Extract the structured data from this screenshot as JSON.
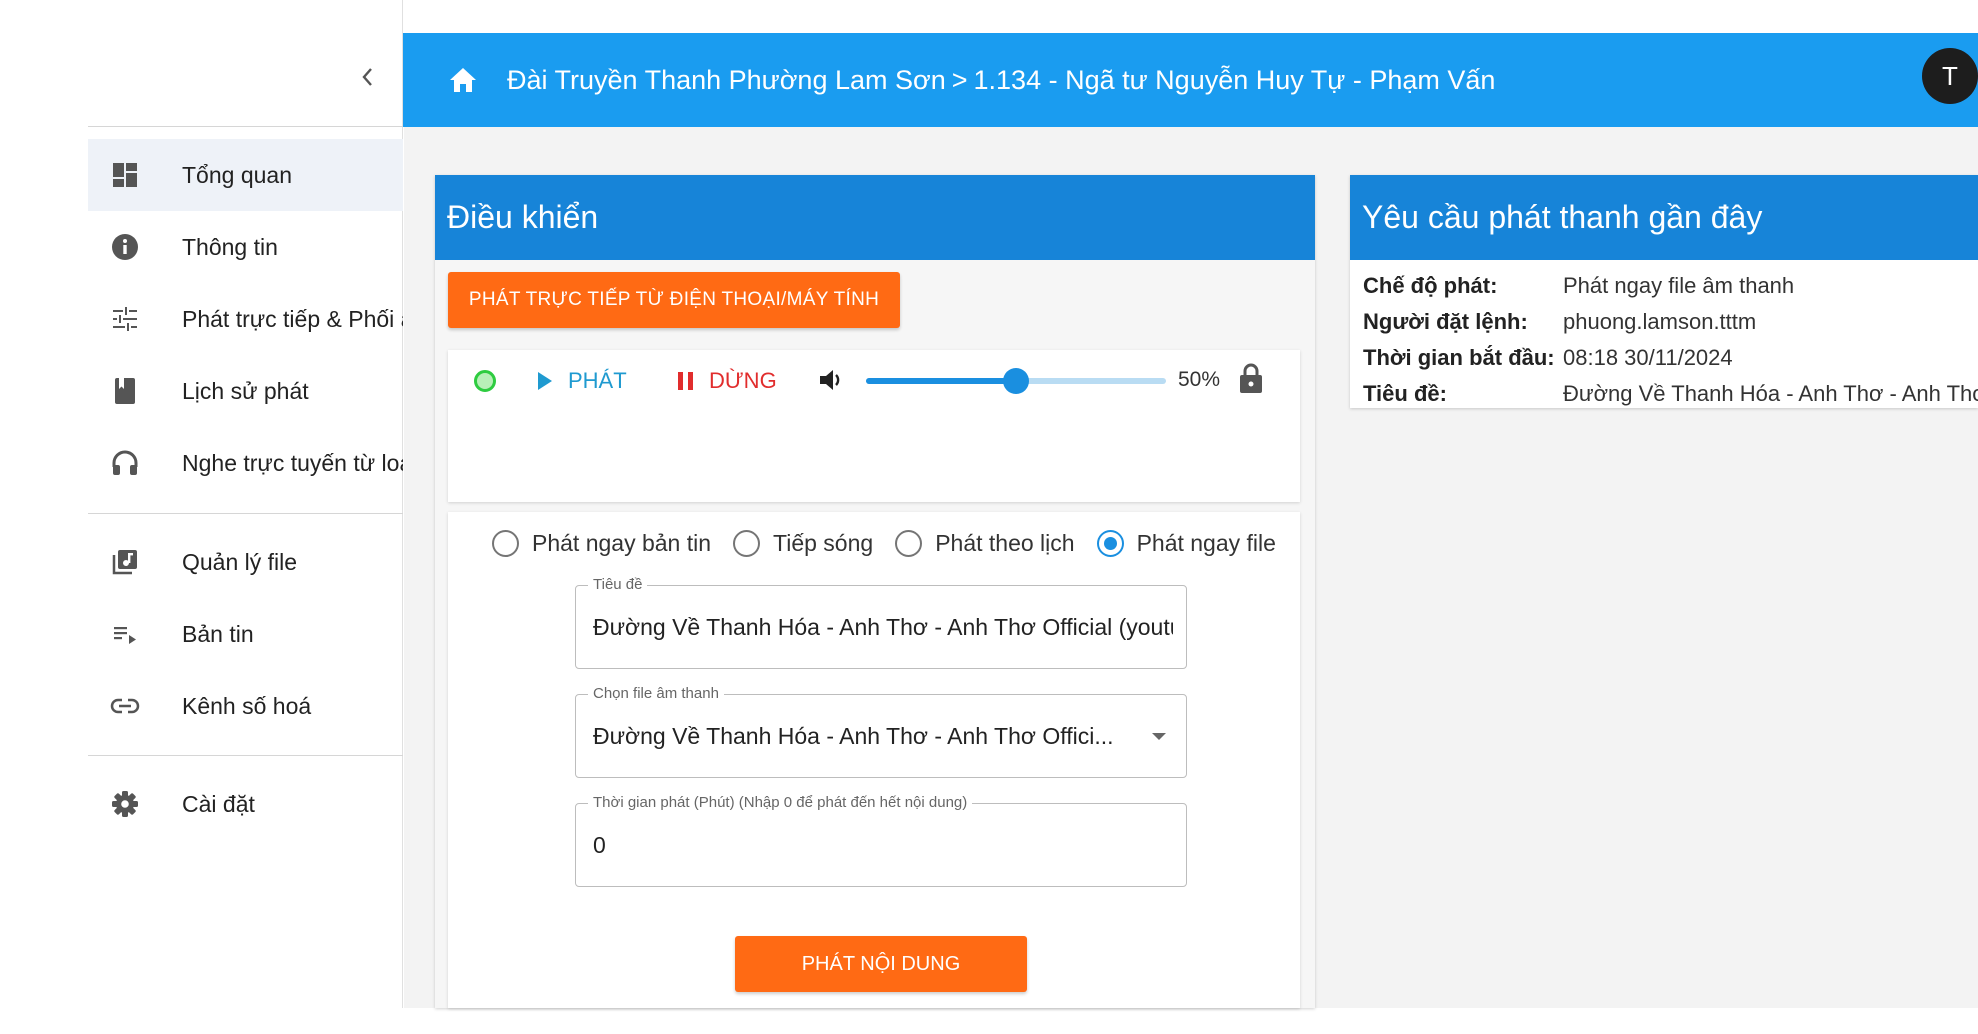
{
  "sidebar": {
    "items": [
      {
        "label": "Tổng quan",
        "icon": "dashboard-icon",
        "active": true
      },
      {
        "label": "Thông tin",
        "icon": "info-icon"
      },
      {
        "label": "Phát trực tiếp & Phối âm",
        "icon": "mixer-sliders-icon"
      },
      {
        "label": "Lịch sử phát",
        "icon": "book-icon"
      },
      {
        "label": "Nghe trực tuyến từ loa",
        "icon": "headphones-icon"
      },
      {
        "label": "Quản lý file",
        "icon": "library-music-icon"
      },
      {
        "label": "Bản tin",
        "icon": "playlist-play-icon"
      },
      {
        "label": "Kênh số hoá",
        "icon": "link-icon"
      },
      {
        "label": "Cài đặt",
        "icon": "gear-icon"
      }
    ]
  },
  "header": {
    "breadcrumb_root": "Đài Truyền Thanh Phường Lam Sơn",
    "breadcrumb_sep": ">",
    "breadcrumb_current": "1.134 - Ngã tư Nguyễn Huy Tự - Phạm Vấn",
    "avatar_initial": "T",
    "color": "#1a9cf0"
  },
  "control": {
    "title": "Điều khiển",
    "live_button": "PHÁT TRỰC TIẾP TỪ ĐIỆN THOẠI/MÁY TÍNH",
    "play_label": "PHÁT",
    "stop_label": "DỪNG",
    "volume": 50,
    "volume_text": "50%",
    "modes": [
      {
        "label": "Phát ngay bản tin",
        "checked": false
      },
      {
        "label": "Tiếp sóng",
        "checked": false
      },
      {
        "label": "Phát theo lịch",
        "checked": false
      },
      {
        "label": "Phát ngay file",
        "checked": true
      }
    ],
    "title_field": {
      "label": "Tiêu đề",
      "value": "Đường Về Thanh Hóa - Anh Thơ - Anh Thơ Official (youtube)"
    },
    "file_field": {
      "label": "Chọn file âm thanh",
      "value": "Đường Về Thanh Hóa - Anh Thơ - Anh Thơ Offici..."
    },
    "duration_field": {
      "label": "Thời gian phát (Phút) (Nhập 0 để phát đến hết nội dung)",
      "value": "0"
    },
    "submit_button": "PHÁT NỘI DUNG"
  },
  "recent": {
    "title": "Yêu cầu phát thanh gần đây",
    "rows": [
      {
        "key": "Chế độ phát:",
        "value": "Phát ngay file âm thanh"
      },
      {
        "key": "Người đặt lệnh:",
        "value": "phuong.lamson.tttm"
      },
      {
        "key": "Thời gian bắt đầu:",
        "value": "08:18 30/11/2024"
      },
      {
        "key": "Tiêu đề:",
        "value": "Đường Về Thanh Hóa - Anh Thơ - Anh Thơ Official"
      }
    ]
  },
  "colors": {
    "accent": "#1784d8",
    "action": "#ff6a14",
    "play": "#1f9ad0",
    "stop": "#e12d2d"
  }
}
